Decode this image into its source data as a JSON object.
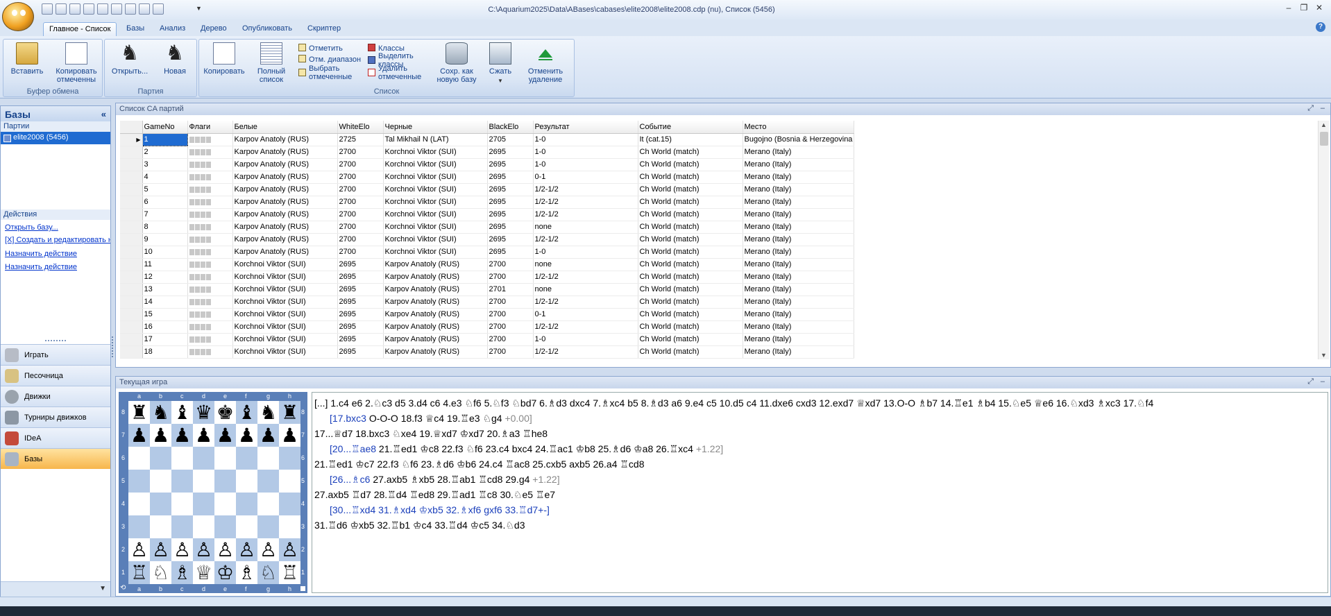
{
  "window": {
    "title": "C:\\Aquarium2025\\Data\\ABases\\cabases\\elite2008\\elite2008.cdp (nu), Список (5456)"
  },
  "tabs": [
    "Главное - Список",
    "Базы",
    "Анализ",
    "Дерево",
    "Опубликовать",
    "Скриптер"
  ],
  "ribbon": {
    "clipboard": {
      "label": "Буфер обмена",
      "paste": "Вставить",
      "copy_marked_1": "Копировать",
      "copy_marked_2": "отмеченны"
    },
    "game": {
      "label": "Партия",
      "open": "Открыть...",
      "new": "Новая"
    },
    "list": {
      "label": "Список",
      "copy": "Копировать",
      "full_list_1": "Полный",
      "full_list_2": "список",
      "mark": "Отметить",
      "mark_range": "Отм. диапазон",
      "select_marked_1": "Выбрать",
      "select_marked_2": "отмеченные",
      "classes": "Классы",
      "highlight_classes_1": "Выделить",
      "highlight_classes_2": "классы",
      "delete_marked_1": "Удалить",
      "delete_marked_2": "отмеченные",
      "save_as_1": "Сохр. как",
      "save_as_2": "новую базу",
      "compress": "Сжать",
      "undo_delete_1": "Отменить",
      "undo_delete_2": "удаление"
    }
  },
  "left_panel": {
    "title": "Базы",
    "games_label": "Партии",
    "db_item": "elite2008 (5456)",
    "actions_label": "Действия",
    "links": [
      "Открыть базу...",
      "[X] Создать и редактировать новую",
      "Назначить действие",
      "Назначить действие"
    ],
    "nav": [
      "Играть",
      "Песочница",
      "Движки",
      "Турниры движков",
      "IDeA",
      "Базы"
    ]
  },
  "game_list": {
    "title": "Список CA партий",
    "columns": [
      "GameNo",
      "Флаги",
      "Белые",
      "WhiteElo",
      "Черные",
      "BlackElo",
      "Результат",
      "Событие",
      "Место"
    ],
    "rows": [
      [
        "1",
        "",
        "Karpov Anatoly (RUS)",
        "2725",
        "Tal Mikhail N (LAT)",
        "2705",
        "1-0",
        "It (cat.15)",
        "Bugojno (Bosnia & Herzegovina"
      ],
      [
        "2",
        "",
        "Karpov Anatoly (RUS)",
        "2700",
        "Korchnoi Viktor (SUI)",
        "2695",
        "1-0",
        "Ch World (match)",
        "Merano (Italy)"
      ],
      [
        "3",
        "",
        "Karpov Anatoly (RUS)",
        "2700",
        "Korchnoi Viktor (SUI)",
        "2695",
        "1-0",
        "Ch World (match)",
        "Merano (Italy)"
      ],
      [
        "4",
        "",
        "Karpov Anatoly (RUS)",
        "2700",
        "Korchnoi Viktor (SUI)",
        "2695",
        "0-1",
        "Ch World (match)",
        "Merano (Italy)"
      ],
      [
        "5",
        "",
        "Karpov Anatoly (RUS)",
        "2700",
        "Korchnoi Viktor (SUI)",
        "2695",
        "1/2-1/2",
        "Ch World (match)",
        "Merano (Italy)"
      ],
      [
        "6",
        "",
        "Karpov Anatoly (RUS)",
        "2700",
        "Korchnoi Viktor (SUI)",
        "2695",
        "1/2-1/2",
        "Ch World (match)",
        "Merano (Italy)"
      ],
      [
        "7",
        "",
        "Karpov Anatoly (RUS)",
        "2700",
        "Korchnoi Viktor (SUI)",
        "2695",
        "1/2-1/2",
        "Ch World (match)",
        "Merano (Italy)"
      ],
      [
        "8",
        "",
        "Karpov Anatoly (RUS)",
        "2700",
        "Korchnoi Viktor (SUI)",
        "2695",
        "none",
        "Ch World (match)",
        "Merano (Italy)"
      ],
      [
        "9",
        "",
        "Karpov Anatoly (RUS)",
        "2700",
        "Korchnoi Viktor (SUI)",
        "2695",
        "1/2-1/2",
        "Ch World (match)",
        "Merano (Italy)"
      ],
      [
        "10",
        "",
        "Karpov Anatoly (RUS)",
        "2700",
        "Korchnoi Viktor (SUI)",
        "2695",
        "1-0",
        "Ch World (match)",
        "Merano (Italy)"
      ],
      [
        "11",
        "",
        "Korchnoi Viktor (SUI)",
        "2695",
        "Karpov Anatoly (RUS)",
        "2700",
        "none",
        "Ch World (match)",
        "Merano (Italy)"
      ],
      [
        "12",
        "",
        "Korchnoi Viktor (SUI)",
        "2695",
        "Karpov Anatoly (RUS)",
        "2700",
        "1/2-1/2",
        "Ch World (match)",
        "Merano (Italy)"
      ],
      [
        "13",
        "",
        "Korchnoi Viktor (SUI)",
        "2695",
        "Karpov Anatoly (RUS)",
        "2701",
        "none",
        "Ch World (match)",
        "Merano (Italy)"
      ],
      [
        "14",
        "",
        "Korchnoi Viktor (SUI)",
        "2695",
        "Karpov Anatoly (RUS)",
        "2700",
        "1/2-1/2",
        "Ch World (match)",
        "Merano (Italy)"
      ],
      [
        "15",
        "",
        "Korchnoi Viktor (SUI)",
        "2695",
        "Karpov Anatoly (RUS)",
        "2700",
        "0-1",
        "Ch World (match)",
        "Merano (Italy)"
      ],
      [
        "16",
        "",
        "Korchnoi Viktor (SUI)",
        "2695",
        "Karpov Anatoly (RUS)",
        "2700",
        "1/2-1/2",
        "Ch World (match)",
        "Merano (Italy)"
      ],
      [
        "17",
        "",
        "Korchnoi Viktor (SUI)",
        "2695",
        "Karpov Anatoly (RUS)",
        "2700",
        "1-0",
        "Ch World (match)",
        "Merano (Italy)"
      ],
      [
        "18",
        "",
        "Korchnoi Viktor (SUI)",
        "2695",
        "Karpov Anatoly (RUS)",
        "2700",
        "1/2-1/2",
        "Ch World (match)",
        "Merano (Italy)"
      ]
    ]
  },
  "current_game": {
    "title": "Текущая игра",
    "files": [
      "a",
      "b",
      "c",
      "d",
      "e",
      "f",
      "g",
      "h"
    ],
    "ranks": [
      "8",
      "7",
      "6",
      "5",
      "4",
      "3",
      "2",
      "1"
    ],
    "board": [
      "♜♞♝♛♚♝♞♜",
      "♟♟♟♟♟♟♟♟",
      "        ",
      "        ",
      "        ",
      "        ",
      "♙♙♙♙♙♙♙♙",
      "♖♘♗♕♔♗♘♖"
    ],
    "notation": {
      "main1": "[...] 1.c4 e6 2.♘c3 d5 3.d4 c6 4.e3 ♘f6 5.♘f3 ♘bd7 6.♗d3 dxc4 7.♗xc4 b5 8.♗d3 a6 9.e4 c5 10.d5 c4 11.dxe6 cxd3 12.exd7 ♕xd7 13.O-O ♗b7 14.♖e1 ♗b4 15.♘e5 ♕e6 16.♘xd3 ♗xc3 17.♘f4",
      "var1_move": "[17.bxc3",
      "var1_text": " O-O-O 18.f3 ♕c4 19.♖e3 ♘g4 ",
      "var1_eval": "+0.00]",
      "main2": "17...♕d7 18.bxc3 ♘xe4 19.♕xd7 ♔xd7 20.♗a3 ♖he8",
      "var2_move": "[20...♖ae8",
      "var2_text": " 21.♖ed1 ♔c8 22.f3 ♘f6 23.c4 bxc4 24.♖ac1 ♔b8 25.♗d6 ♔a8 26.♖xc4 ",
      "var2_eval": "+1.22]",
      "main3": "21.♖ed1 ♔c7 22.f3 ♘f6 23.♗d6 ♔b6 24.c4 ♖ac8 25.cxb5 axb5 26.a4 ♖cd8",
      "var3_move": "[26...♗c6",
      "var3_text": " 27.axb5 ♗xb5 28.♖ab1 ♖cd8 29.g4 ",
      "var3_eval": "+1.22]",
      "main4": "27.axb5 ♖d7 28.♖d4 ♖ed8 29.♖ad1 ♖c8 30.♘e5 ♖e7",
      "var4_move": "[30...♖xd4",
      "var4_text": " 31.♗xd4 ♔xb5 32.♗xf6 gxf6 33.♖d7+-",
      "var4_end": "]",
      "main5": "31.♖d6 ♔xb5 32.♖b1 ♔c4 33.♖d4 ♔c5 34.♘d3"
    }
  },
  "colors": {
    "accent": "#1f6bd1",
    "ribbon_text": "#15428b",
    "variation": "#1a3fbb",
    "board_light": "#ffffff",
    "board_dark": "#b3c9e6"
  }
}
